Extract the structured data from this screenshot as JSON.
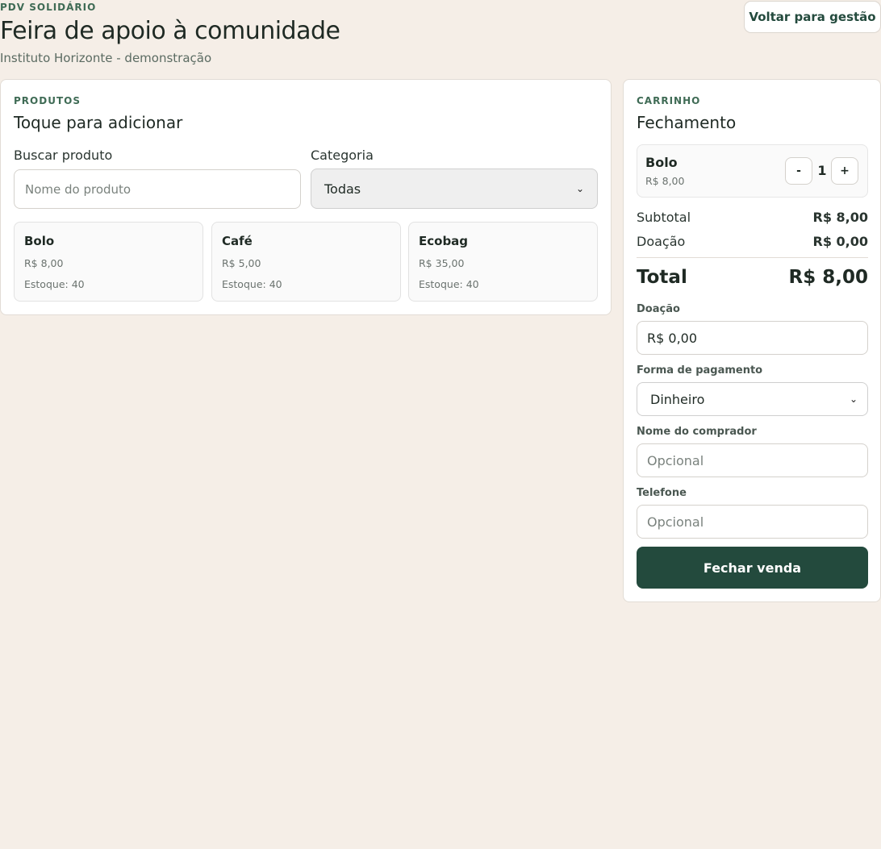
{
  "header": {
    "eyebrow": "PDV SOLIDÁRIO",
    "title": "Feira de apoio à comunidade",
    "subtitle": "Instituto Horizonte - demonstração",
    "back_label": "Voltar para gestão"
  },
  "products_panel": {
    "eyebrow": "PRODUTOS",
    "title": "Toque para adicionar",
    "search_label": "Buscar produto",
    "search_placeholder": "Nome do produto",
    "category_label": "Categoria",
    "category_value": "Todas",
    "products": [
      {
        "name": "Bolo",
        "price": "R$ 8,00",
        "stock": "Estoque: 40"
      },
      {
        "name": "Café",
        "price": "R$ 5,00",
        "stock": "Estoque: 40"
      },
      {
        "name": "Ecobag",
        "price": "R$ 35,00",
        "stock": "Estoque: 40"
      }
    ]
  },
  "cart": {
    "eyebrow": "CARRINHO",
    "title": "Fechamento",
    "items": [
      {
        "name": "Bolo",
        "price": "R$ 8,00",
        "qty": "1",
        "dec_label": "-",
        "inc_label": "+"
      }
    ],
    "subtotal_label": "Subtotal",
    "subtotal_value": "R$ 8,00",
    "donation_label": "Doação",
    "donation_value": "R$ 0,00",
    "total_label": "Total",
    "total_value": "R$ 8,00",
    "donation_field_label": "Doação",
    "donation_field_value": "R$ 0,00",
    "payment_label": "Forma de pagamento",
    "payment_value": "Dinheiro",
    "buyer_label": "Nome do comprador",
    "buyer_placeholder": "Opcional",
    "phone_label": "Telefone",
    "phone_placeholder": "Opcional",
    "submit_label": "Fechar venda"
  },
  "colors": {
    "background": "#f5eee7",
    "accent": "#234a3d",
    "eyebrow": "#3f6b55"
  }
}
